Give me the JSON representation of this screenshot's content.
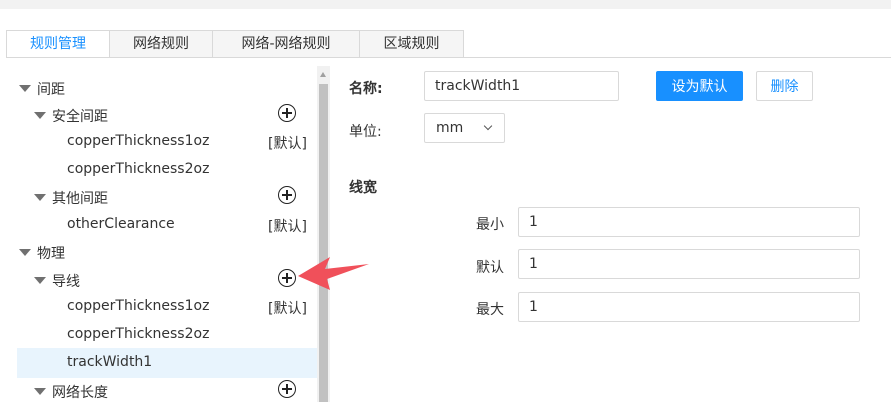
{
  "tabs": [
    {
      "label": "规则管理",
      "active": true
    },
    {
      "label": "网络规则",
      "active": false
    },
    {
      "label": "网络-网络规则",
      "active": false
    },
    {
      "label": "区域规则",
      "active": false
    }
  ],
  "tree": {
    "default_tag": "[默认]",
    "nodes": [
      {
        "label": "间距"
      },
      {
        "label": "安全间距"
      },
      {
        "label": "copperThickness1oz"
      },
      {
        "label": "copperThickness2oz"
      },
      {
        "label": "其他间距"
      },
      {
        "label": "otherClearance"
      },
      {
        "label": "物理"
      },
      {
        "label": "导线"
      },
      {
        "label": "copperThickness1oz"
      },
      {
        "label": "copperThickness2oz"
      },
      {
        "label": "trackWidth1"
      },
      {
        "label": "网络长度"
      }
    ]
  },
  "form": {
    "name_label": "名称:",
    "name_value": "trackWidth1",
    "set_default_button": "设为默认",
    "delete_button": "删除",
    "unit_label": "单位:",
    "unit_value": "mm",
    "section_title": "线宽",
    "min_label": "最小",
    "min_value": "1",
    "default_label": "默认",
    "default_value": "1",
    "max_label": "最大",
    "max_value": "1"
  },
  "colors": {
    "accent": "#1890ff",
    "selected_row": "#e8f4fd",
    "annotation_arrow": "#f0505a"
  }
}
